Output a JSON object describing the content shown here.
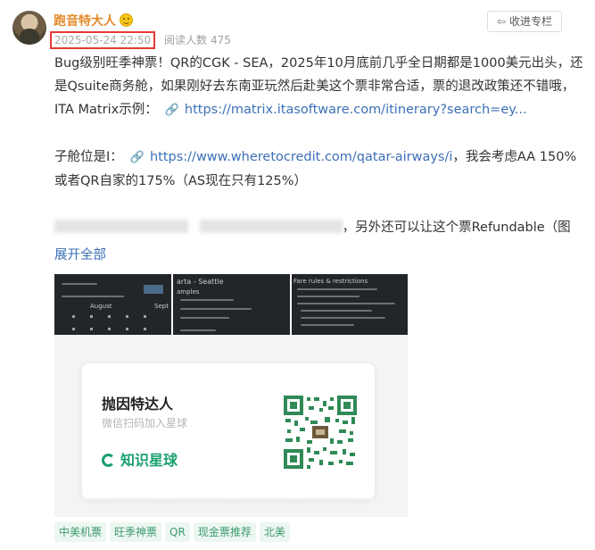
{
  "post": {
    "author": "跑音特大人",
    "date": "2025-05-24 22:50",
    "reads_label": "阅读人数",
    "reads_count": "475",
    "follow_label": "收进专栏"
  },
  "content": {
    "p1_text": "Bug级别旺季神票！QR的CGK - SEA，2025年10月底前几乎全日期都是1000美元出头，还是Qsuite商务舱，如果刚好去东南亚玩然后赴美这个票非常合适，票的退改政策还不错哦，ITA Matrix示例：",
    "p1_link": "https://matrix.itasoftware.com/itinerary?search=ey...",
    "p2_prefix": "子舱位是I：",
    "p2_link": "https://www.wheretocredit.com/qatar-airways/i",
    "p2_suffix": "，我会考虑AA 150%或者QR自家的175%（AS现在只有125%）",
    "p3_suffix": "，另外还可以让这个票Refundable（图",
    "expand": "展开全部"
  },
  "screenshots": {
    "s1_label": "August",
    "s1_label2": "Sept",
    "s2_label": "arta - Seattle",
    "s2_label2": "amples",
    "s3_label": "Fare rules & restrictions"
  },
  "qr_card": {
    "title": "抛因特达人",
    "subtitle": "微信扫码加入星球",
    "brand": "知识星球"
  },
  "tags": [
    "中美机票",
    "旺季神票",
    "QR",
    "现金票推荐",
    "北美"
  ],
  "colors": {
    "author": "#e28a2b",
    "date_highlight": "#e53935",
    "link": "#3b6fb6",
    "tag_text": "#3d9b6f",
    "tag_bg": "#edf7f1",
    "brand_green": "#19a06f"
  }
}
